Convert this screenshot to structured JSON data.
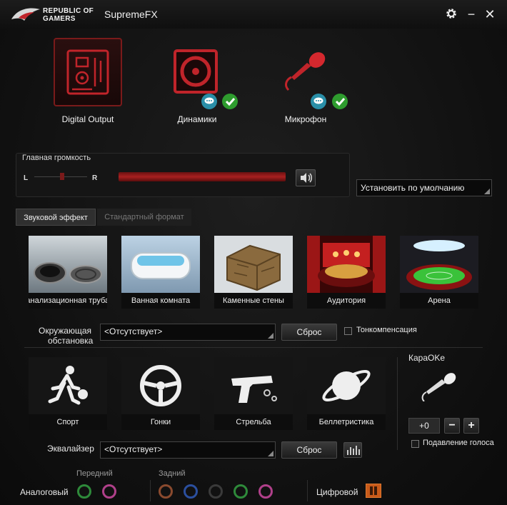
{
  "titlebar": {
    "brand_line1": "REPUBLIC OF",
    "brand_line2": "GAMERS",
    "app_title": "SupremeFX",
    "settings_icon": "gear-icon",
    "minimize_glyph": "−",
    "close_glyph": "✕"
  },
  "devices": [
    {
      "label": "Digital Output",
      "icon": "circuit-board-icon"
    },
    {
      "label": "Динамики",
      "icon": "speaker-icon"
    },
    {
      "label": "Микрофон",
      "icon": "microphone-icon"
    }
  ],
  "volume": {
    "title": "Главная громкость",
    "left": "L",
    "right": "R",
    "level": 0.95,
    "balance": 0.5
  },
  "set_default": {
    "label": "Установить по умолчанию"
  },
  "tabs": [
    {
      "label": "Звуковой эффект",
      "active": true
    },
    {
      "label": "Стандартный формат",
      "active": false
    }
  ],
  "environments": [
    {
      "label": "Канализационная труба"
    },
    {
      "label": "Ванная комната"
    },
    {
      "label": "Каменные стены"
    },
    {
      "label": "Аудитория"
    },
    {
      "label": "Арена"
    }
  ],
  "environment": {
    "label_line1": "Окружающая",
    "label_line2": "обстановка",
    "value": "<Отсутствует>",
    "reset": "Сброс",
    "loudness": "Тонкомпенсация"
  },
  "equalizer_presets": [
    {
      "label": "Спорт"
    },
    {
      "label": "Гонки"
    },
    {
      "label": "Стрельба"
    },
    {
      "label": "Беллетристика"
    }
  ],
  "equalizer": {
    "label": "Эквалайзер",
    "value": "<Отсутствует>",
    "reset": "Сброс"
  },
  "karaoke": {
    "title": "КараOKe",
    "value": "+0",
    "minus": "−",
    "plus": "+",
    "voice_cancel": "Подавление голоса"
  },
  "jacks": {
    "front_label": "Передний",
    "rear_label": "Задний",
    "analog_label": "Аналоговый",
    "digital_label": "Цифровой",
    "front": [
      "#2e8a3a",
      "#b0408a"
    ],
    "rear": [
      "#8a4a2e",
      "#2b4f9e",
      "#3a3a3a",
      "#2e8a3a",
      "#b0408a"
    ]
  },
  "colors": {
    "accent": "#c0242a",
    "check": "#2e9c2e",
    "chat": "#2a8fa8"
  }
}
